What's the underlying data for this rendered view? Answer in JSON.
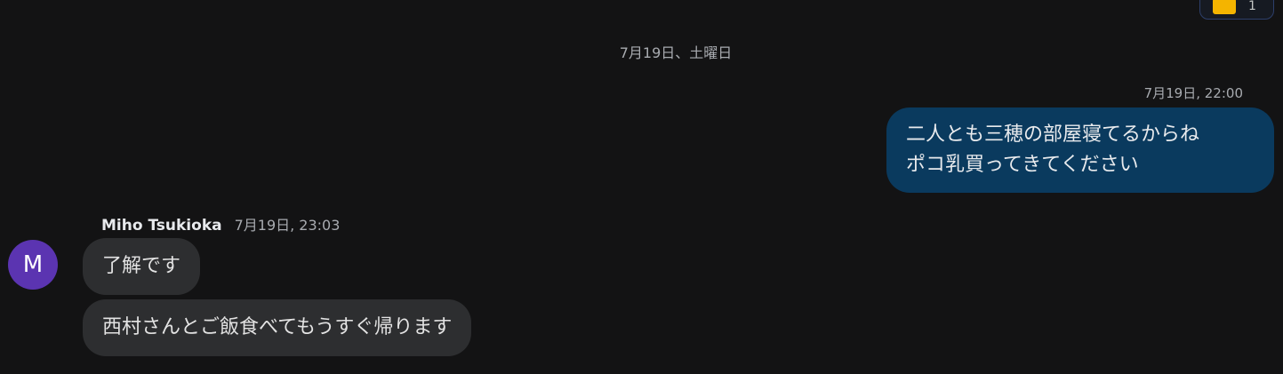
{
  "reaction": {
    "emoji": "thumbs-up",
    "count": "1"
  },
  "date_divider": "7月19日、土曜日",
  "outgoing": {
    "time": "7月19日, 22:00",
    "lines": [
      "二人とも三穂の部屋寝てるからね",
      "ポコ乳買ってきてください"
    ],
    "color": "#0a3a5e"
  },
  "incoming": {
    "avatar_initial": "M",
    "avatar_color": "#5b34b1",
    "sender": "Miho Tsukioka",
    "time": "7月19日, 23:03",
    "messages": [
      "了解です",
      "西村さんとご飯食べてもうすぐ帰ります"
    ]
  }
}
